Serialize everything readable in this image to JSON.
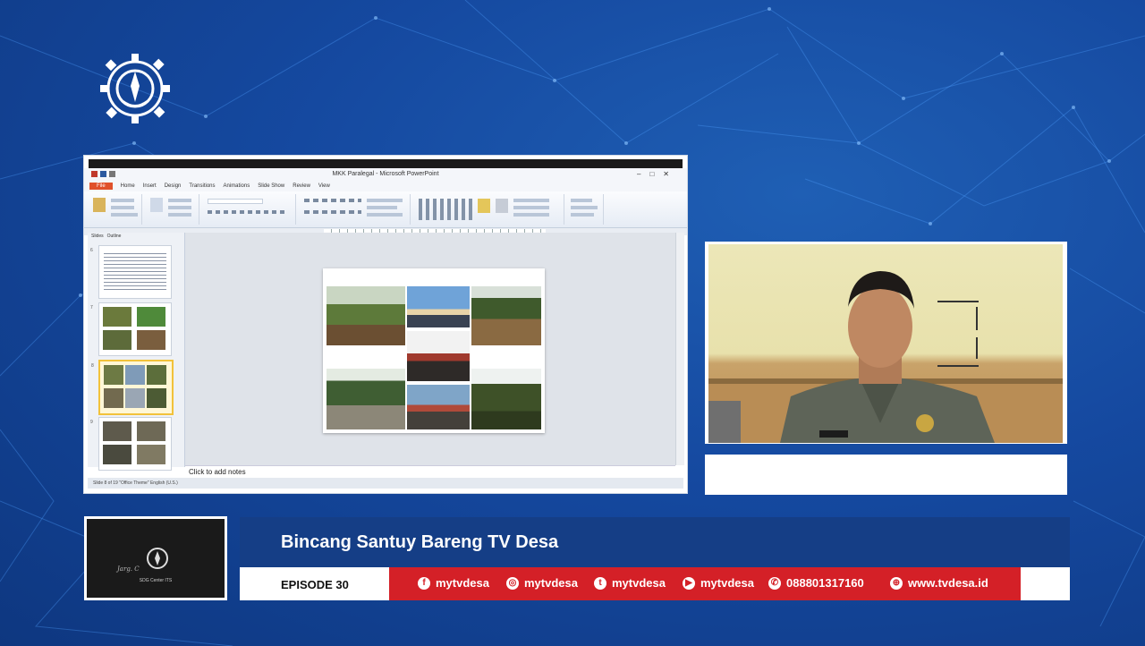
{
  "powerpoint": {
    "window_title": "MKK Paralegal - Microsoft PowerPoint",
    "tabs": [
      "File",
      "Home",
      "Insert",
      "Design",
      "Transitions",
      "Animations",
      "Slide Show",
      "Review",
      "View"
    ],
    "panel_tabs": [
      "Slides",
      "Outline"
    ],
    "notes_placeholder": "Click to add notes",
    "status": "Slide 8 of 19   \"Office Theme\"   English (U.S.)",
    "thumb_numbers": [
      "6",
      "7",
      "8",
      "9"
    ]
  },
  "lower_third": {
    "title": "Bincang Santuy Bareng TV Desa",
    "episode": "EPISODE 30",
    "socials": [
      {
        "icon": "facebook-icon",
        "glyph": "f",
        "label": "mytvdesa"
      },
      {
        "icon": "instagram-icon",
        "glyph": "◎",
        "label": "mytvdesa"
      },
      {
        "icon": "twitter-icon",
        "glyph": "t",
        "label": "mytvdesa"
      },
      {
        "icon": "youtube-icon",
        "glyph": "▶",
        "label": "mytvdesa"
      },
      {
        "icon": "whatsapp-icon",
        "glyph": "✆",
        "label": "088801317160"
      },
      {
        "icon": "globe-icon",
        "glyph": "⊕",
        "label": "www.tvdesa.id"
      }
    ]
  },
  "channel_logo": {
    "caption": "SDG Center ITS"
  },
  "colors": {
    "background": "#1549a0",
    "title_bar": "#153e86",
    "social_bar": "#d42027",
    "ppt_file_tab": "#e0512b"
  }
}
